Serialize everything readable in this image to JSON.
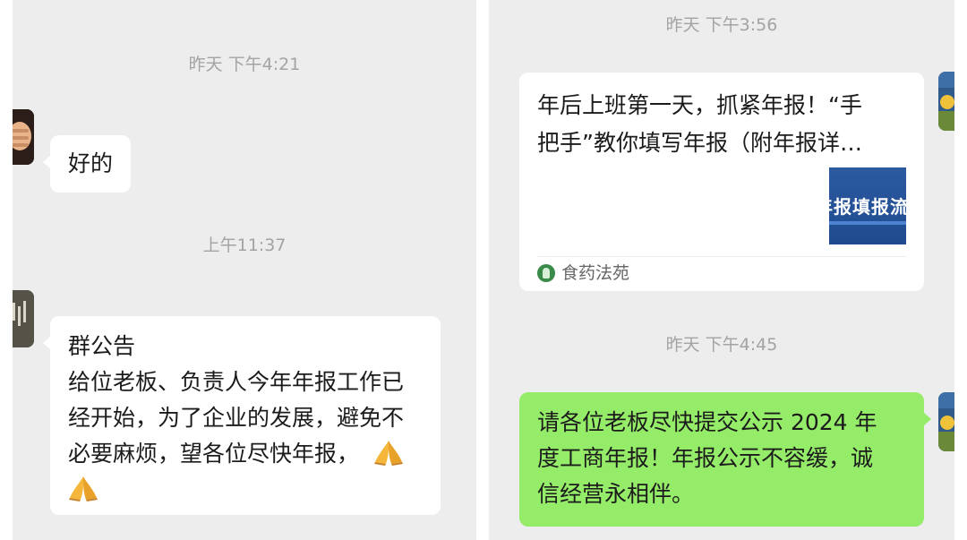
{
  "left_chat": {
    "timestamp_1": "昨天 下午4:21",
    "message_1": "好的",
    "timestamp_2": "上午11:37",
    "announcement": {
      "title": "群公告",
      "line_1": "给位老板、负责人今年年报工作已",
      "line_2": "经开始，为了企业的发展，避免不",
      "line_3": "必要麻烦，望各位尽快年报，",
      "emoji": "folded-hands-emoji"
    }
  },
  "right_chat": {
    "timestamp_1": "昨天 下午3:56",
    "link_card": {
      "title_line_1": "年后上班第一天，抓紧年报！“手",
      "title_line_2": "把手”教你填写年报（附年报详…",
      "thumbnail_text": "年报填报流程",
      "source": "食药法苑",
      "source_icon": "leaf-icon"
    },
    "timestamp_2": "昨天 下午4:45",
    "message_2": {
      "line_1": "请各位老板尽快提交公示 2024 年",
      "line_2": "度工商年报！年报公示不容缓，诚",
      "line_3": "信经营永相伴。"
    }
  },
  "colors": {
    "chat_background": "#ededed",
    "bubble_white": "#ffffff",
    "bubble_green": "#95ec69",
    "timestamp_text": "#a3a3a3",
    "message_text": "#1b1b1b"
  }
}
